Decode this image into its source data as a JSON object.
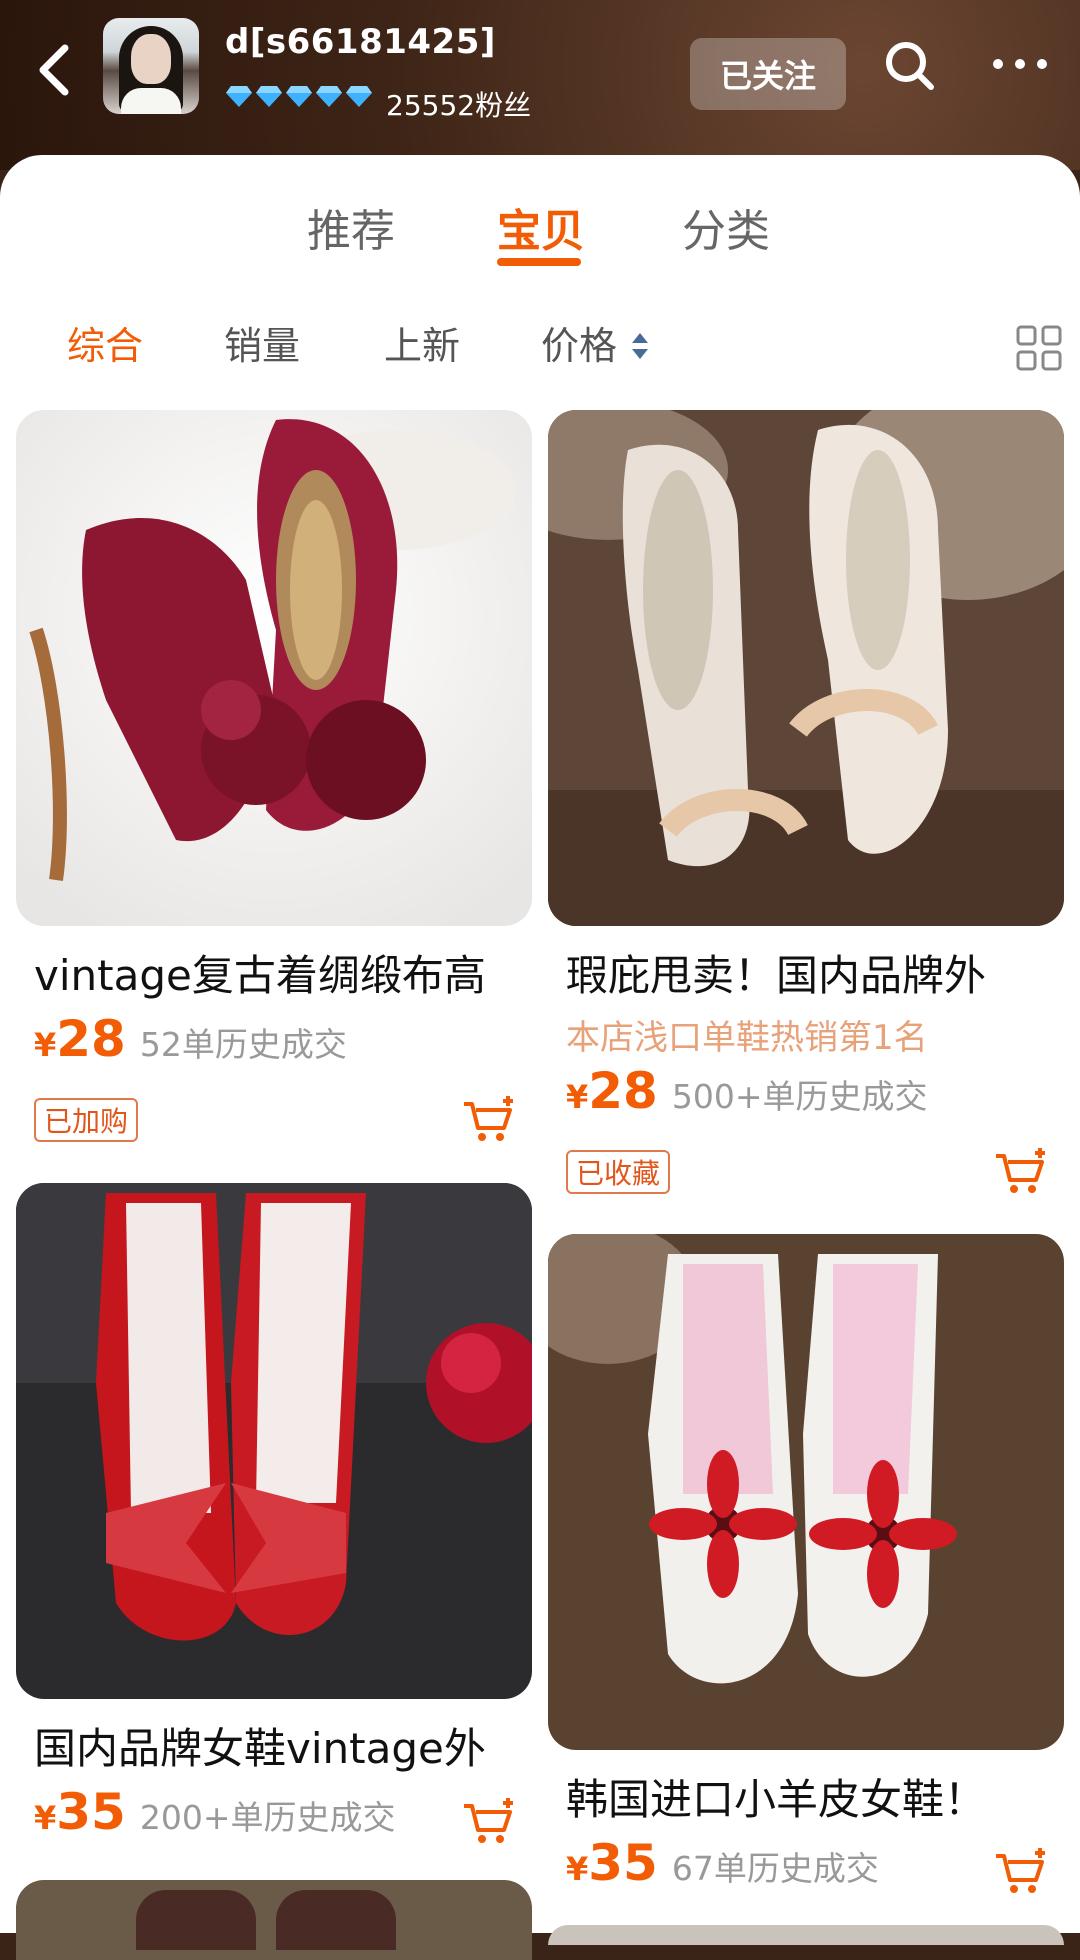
{
  "header": {
    "shop_name": "d[s66181425]",
    "fans": "25552粉丝",
    "follow_label": "已关注",
    "diamond_count": 5
  },
  "tabs": [
    {
      "label": "推荐"
    },
    {
      "label": "宝贝"
    },
    {
      "label": "分类"
    }
  ],
  "sorts": [
    {
      "label": "综合"
    },
    {
      "label": "销量"
    },
    {
      "label": "上新"
    },
    {
      "label": "价格"
    }
  ],
  "products": [
    {
      "title": "vintage复古着绸缎布高",
      "rank": "",
      "currency": "¥",
      "price": "28",
      "sold": "52单历史成交",
      "tag": "已加购"
    },
    {
      "title": "瑕庇甩卖！国内品牌外",
      "rank": "本店浅口单鞋热销第1名",
      "currency": "¥",
      "price": "28",
      "sold": "500+单历史成交",
      "tag": "已收藏"
    },
    {
      "title": "国内品牌女鞋vintage外",
      "rank": "",
      "currency": "¥",
      "price": "35",
      "sold": "200+单历史成交",
      "tag": ""
    },
    {
      "title": "韩国进口小羊皮女鞋！",
      "rank": "",
      "currency": "¥",
      "price": "35",
      "sold": "67单历史成交",
      "tag": ""
    }
  ],
  "colors": {
    "accent": "#f25c05",
    "header_bg": "#3d2416"
  }
}
